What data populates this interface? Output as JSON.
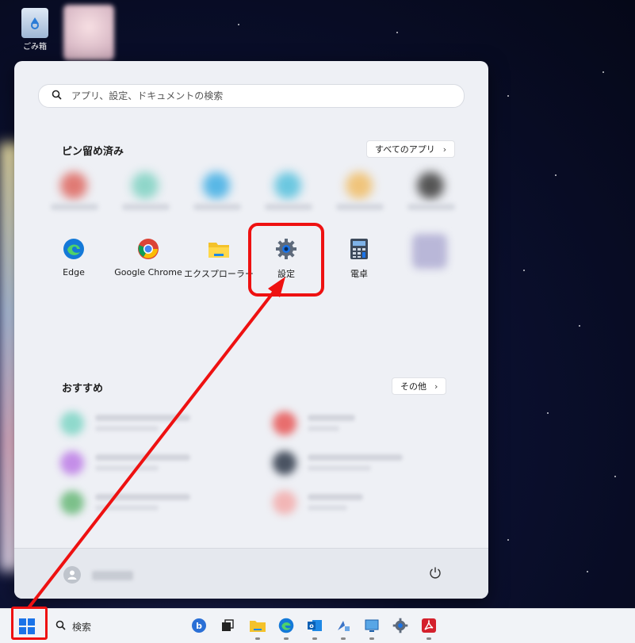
{
  "desktop": {
    "recycle_bin_label": "ごみ箱"
  },
  "start_menu": {
    "search_placeholder": "アプリ、設定、ドキュメントの検索",
    "pinned_title": "ピン留め済み",
    "all_apps_label": "すべてのアプリ",
    "pinned_apps": [
      {
        "label": "Edge",
        "icon": "edge-icon"
      },
      {
        "label": "Google Chrome",
        "icon": "chrome-icon"
      },
      {
        "label": "エクスプローラー",
        "icon": "folder-icon"
      },
      {
        "label": "設定",
        "icon": "gear-icon"
      },
      {
        "label": "電卓",
        "icon": "calculator-icon"
      }
    ],
    "recommended_title": "おすすめ",
    "more_label": "その他"
  },
  "taskbar": {
    "search_label": "検索"
  },
  "colors": {
    "highlight": "#e11",
    "accent": "#1a73e8"
  }
}
